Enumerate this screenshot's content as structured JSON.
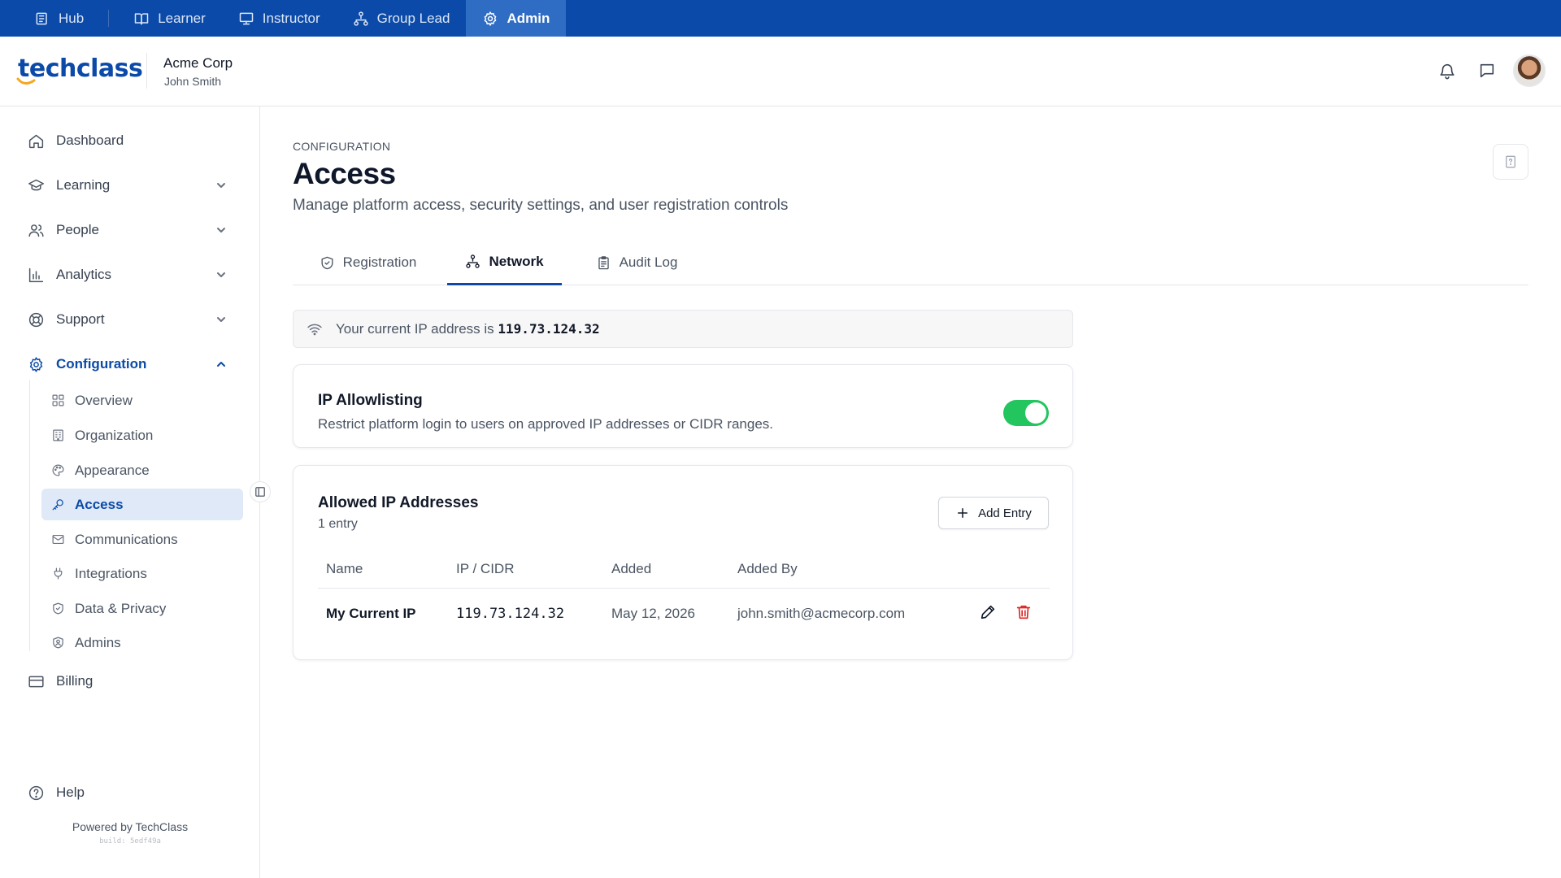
{
  "role_bar": {
    "roles": [
      {
        "label": "Hub",
        "icon": "hub-icon"
      },
      {
        "label": "Learner",
        "icon": "book-icon"
      },
      {
        "label": "Instructor",
        "icon": "presentation-icon"
      },
      {
        "label": "Group Lead",
        "icon": "hierarchy-icon"
      },
      {
        "label": "Admin",
        "icon": "gear-icon"
      }
    ],
    "active": "Admin",
    "colors": {
      "bar": "#0b4aa8",
      "active": "#2f6cc4"
    }
  },
  "header": {
    "logo_text": "techclass",
    "org_name": "Acme Corp",
    "user_name": "John Smith",
    "icons": [
      "bell-icon",
      "chat-icon",
      "avatar"
    ]
  },
  "sidebar": {
    "items": [
      {
        "label": "Dashboard",
        "icon": "home-icon"
      },
      {
        "label": "Learning",
        "icon": "graduation-cap-icon"
      },
      {
        "label": "People",
        "icon": "users-icon"
      },
      {
        "label": "Analytics",
        "icon": "bar-chart-icon"
      },
      {
        "label": "Support",
        "icon": "lifebuoy-icon"
      },
      {
        "label": "Configuration",
        "icon": "gear-icon"
      }
    ],
    "config_items": [
      {
        "label": "Overview",
        "icon": "grid-icon"
      },
      {
        "label": "Organization",
        "icon": "building-icon"
      },
      {
        "label": "Appearance",
        "icon": "palette-icon"
      },
      {
        "label": "Access",
        "icon": "key-icon"
      },
      {
        "label": "Communications",
        "icon": "mail-icon"
      },
      {
        "label": "Integrations",
        "icon": "plug-icon"
      },
      {
        "label": "Data & Privacy",
        "icon": "shield-icon"
      },
      {
        "label": "Admins",
        "icon": "user-shield-icon"
      }
    ],
    "billing": {
      "label": "Billing",
      "icon": "credit-card-icon"
    },
    "help": {
      "label": "Help",
      "icon": "help-circle-icon"
    },
    "powered_by": "Powered by TechClass",
    "build": "build: 5edf49a"
  },
  "main": {
    "breadcrumb": "CONFIGURATION",
    "title": "Access",
    "subtitle": "Manage platform access, security settings, and user registration controls",
    "tabs": [
      {
        "label": "Registration",
        "icon": "shield-check-icon"
      },
      {
        "label": "Network",
        "icon": "network-icon"
      },
      {
        "label": "Audit Log",
        "icon": "clipboard-icon"
      }
    ],
    "active_tab": "Network",
    "ip_banner": {
      "prefix": "Your current IP address is",
      "ip": "119.73.124.32"
    },
    "allowlisting": {
      "title": "IP Allowlisting",
      "description": "Restrict platform login to users on approved IP addresses or CIDR ranges.",
      "enabled": true,
      "toggle_color": "#22c55e"
    },
    "allowed": {
      "title": "Allowed IP Addresses",
      "count": "1 entry",
      "add_label": "Add Entry",
      "columns": [
        "Name",
        "IP / CIDR",
        "Added",
        "Added By"
      ],
      "rows": [
        {
          "name": "My Current IP",
          "ip": "119.73.124.32",
          "added": "May 12, 2026",
          "added_by": "john.smith@acmecorp.com"
        }
      ]
    }
  }
}
